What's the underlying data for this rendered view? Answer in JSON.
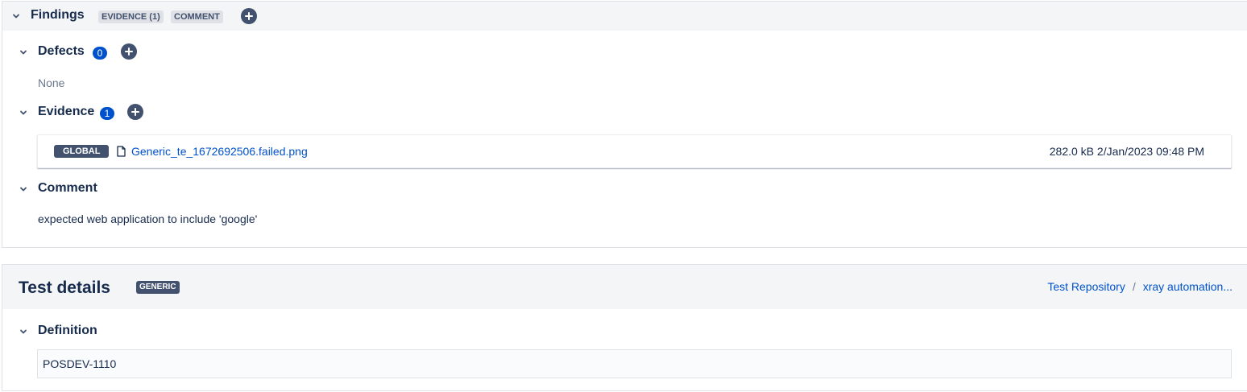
{
  "findings": {
    "title": "Findings",
    "badges": [
      "EVIDENCE (1)",
      "COMMENT"
    ],
    "defects": {
      "title": "Defects",
      "count": "0",
      "empty_text": "None"
    },
    "evidence": {
      "title": "Evidence",
      "count": "1",
      "items": [
        {
          "scope": "GLOBAL",
          "filename": "Generic_te_1672692506.failed.png",
          "meta": "282.0 kB  2/Jan/2023 09:48 PM"
        }
      ]
    },
    "comment": {
      "title": "Comment",
      "text": "expected web application to include 'google'"
    }
  },
  "test_details": {
    "title": "Test details",
    "type_badge": "GENERIC",
    "breadcrumb": [
      "Test Repository",
      "xray automation..."
    ],
    "breadcrumb_separator": "/",
    "definition": {
      "title": "Definition",
      "value": "POSDEV-1110"
    }
  }
}
